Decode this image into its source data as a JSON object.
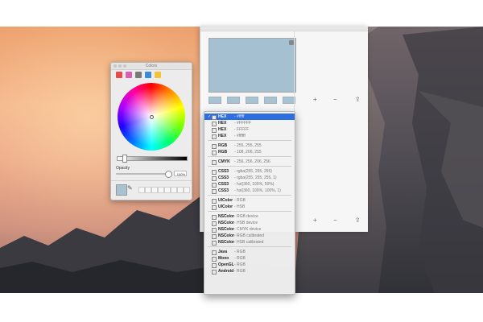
{
  "picker": {
    "title": "Colors",
    "opacity_label": "Opacity",
    "opacity_value": "100%",
    "toolbar": [
      {
        "icon": "color-wheel-icon",
        "color": "#e64a4a"
      },
      {
        "icon": "color-sliders-icon",
        "color": "#d65fb0"
      },
      {
        "icon": "color-palettes-icon",
        "color": "#7a7a7a"
      },
      {
        "icon": "image-palettes-icon",
        "color": "#3f8ad6"
      },
      {
        "icon": "crayons-icon",
        "color": "#f2c43a"
      }
    ],
    "current_color": "#a6c2d3"
  },
  "app": {
    "preview_color": "#a5c1d1",
    "add": "+",
    "remove": "−",
    "share": "⇪"
  },
  "menu": {
    "items": [
      {
        "label": "HEX",
        "value": "- #fffff",
        "selected": true,
        "checked": true
      },
      {
        "label": "HEX",
        "value": "- #FFFFF"
      },
      {
        "label": "HEX",
        "value": "- FFFFF"
      },
      {
        "label": "HEX",
        "value": "- #ffffff"
      },
      {
        "sep": true
      },
      {
        "label": "RGB",
        "value": "- 255, 255, 255"
      },
      {
        "label": "RGB",
        "value": "- 108, 206, 255"
      },
      {
        "sep": true
      },
      {
        "label": "CMYK",
        "value": "- 256, 256, 206, 256"
      },
      {
        "sep": true
      },
      {
        "label": "CSS3",
        "value": "- rgba(255, 255, 255)"
      },
      {
        "label": "CSS3",
        "value": "- rgba(255, 255, 255, 1)"
      },
      {
        "label": "CSS3",
        "value": "- hsl(360, 100%, 50%)"
      },
      {
        "label": "CSS3",
        "value": "- hsl(360, 100%, 100%, 1)"
      },
      {
        "sep": true
      },
      {
        "label": "UIColor",
        "value": "- RGB"
      },
      {
        "label": "UIColor",
        "value": "- HSB"
      },
      {
        "sep": true
      },
      {
        "label": "NSColor",
        "value": "- RGB device"
      },
      {
        "label": "NSColor",
        "value": "- HSB device"
      },
      {
        "label": "NSColor",
        "value": "- CMYK device"
      },
      {
        "label": "NSColor",
        "value": "- RGB calibrated"
      },
      {
        "label": "NSColor",
        "value": "- HSB calibrated"
      },
      {
        "sep": true
      },
      {
        "label": "Java",
        "value": "- RGB"
      },
      {
        "label": "Mono",
        "value": "- RGB"
      },
      {
        "label": "OpenGL",
        "value": "- RGB"
      },
      {
        "label": "Android",
        "value": "- RGB"
      }
    ]
  }
}
